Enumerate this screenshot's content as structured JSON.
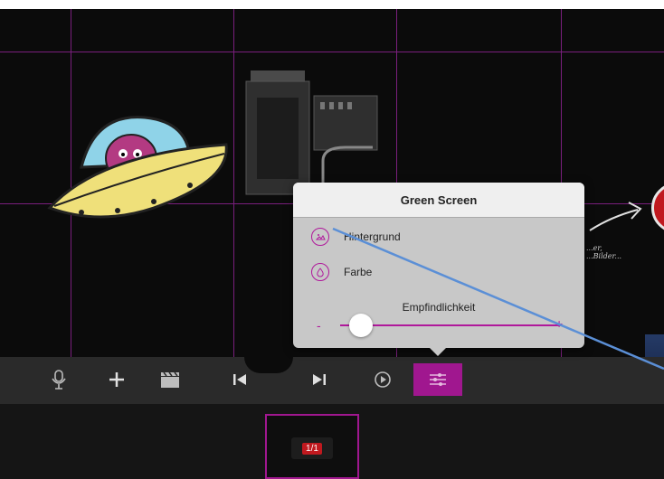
{
  "popover": {
    "title": "Green Screen",
    "options": [
      {
        "label": "Hintergrund",
        "icon": "image-icon"
      },
      {
        "label": "Farbe",
        "icon": "drop-icon"
      }
    ],
    "slider": {
      "label": "Empfindlichkeit",
      "min_label": "-",
      "max_label": "+",
      "value": 0.1
    }
  },
  "scene": {
    "note": "...er,\n...Bilder..."
  },
  "toolbar": {
    "items": [
      {
        "name": "mic-icon",
        "glyph": "🎙"
      },
      {
        "name": "add-icon",
        "glyph": "+"
      },
      {
        "name": "clapperboard-icon",
        "glyph": "🎬"
      },
      {
        "name": "skip-back-icon",
        "glyph": "⏮"
      },
      {
        "name": "skip-forward-icon",
        "glyph": "⏭"
      },
      {
        "name": "play-icon",
        "glyph": "▶"
      },
      {
        "name": "adjust-icon",
        "glyph": "≡"
      }
    ]
  },
  "tray": {
    "thumbnail_badge": "1/1"
  },
  "colors": {
    "accent": "#a0178f",
    "background": "#0b0b0b",
    "grid": "#7a1f7d",
    "pointer": "#5b8fd6"
  }
}
